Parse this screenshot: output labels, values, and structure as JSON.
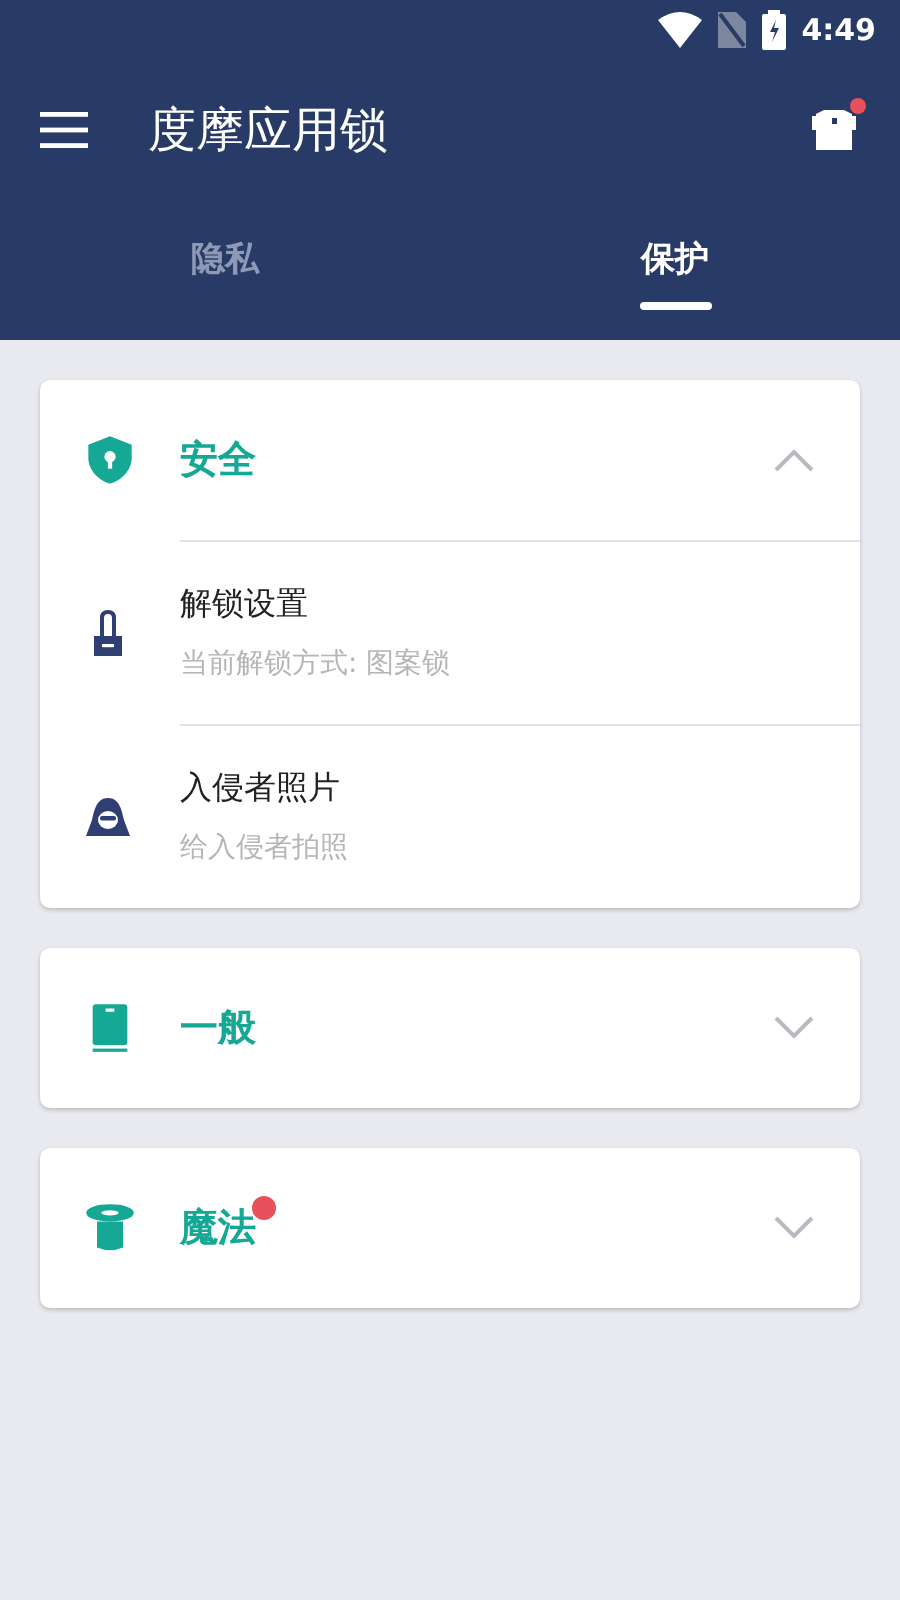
{
  "status_bar": {
    "time": "4:49"
  },
  "toolbar": {
    "title": "度摩应用锁",
    "action_badge": true
  },
  "tabs": [
    {
      "label": "隐私",
      "selected": false
    },
    {
      "label": "保护",
      "selected": true
    }
  ],
  "sections": [
    {
      "kind": "shield",
      "title": "安全",
      "expanded": true,
      "badge": false,
      "items": [
        {
          "kind": "lock",
          "title": "解锁设置",
          "subtitle": "当前解锁方式: 图案锁"
        },
        {
          "kind": "intruder",
          "title": "入侵者照片",
          "subtitle": "给入侵者拍照"
        }
      ]
    },
    {
      "kind": "phone",
      "title": "一般",
      "expanded": false,
      "badge": false
    },
    {
      "kind": "hat",
      "title": "魔法",
      "expanded": false,
      "badge": true
    }
  ]
}
